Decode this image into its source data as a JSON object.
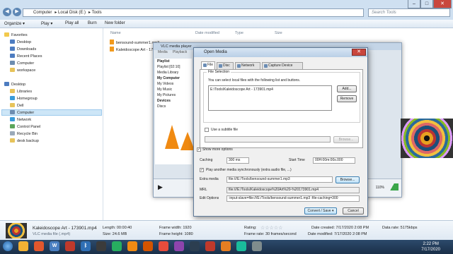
{
  "explorer": {
    "breadcrumb": [
      "Computer",
      "Local Disk (E:)",
      "Tools"
    ],
    "search_placeholder": "Search Tools",
    "toolbar": {
      "organize": "Organize ▾",
      "play": "Play ▾",
      "play_all": "Play all",
      "burn": "Burn",
      "new_folder": "New folder"
    },
    "columns": {
      "name": "Name",
      "date": "Date modified",
      "type": "Type",
      "size": "Size"
    },
    "files": [
      "bensound-summer1.mp3",
      "Kaleidoscope Art - 17"
    ],
    "tree": {
      "favorites": "Favorites",
      "fav_items": [
        "Desktop",
        "Downloads",
        "Recent Places",
        "Computer",
        "workspace"
      ],
      "desktop": "Desktop",
      "desk_items": [
        "Libraries",
        "Homegroup",
        "Dell",
        "Computer",
        "Network",
        "Control Panel",
        "Recycle Bin",
        "desk backup"
      ]
    }
  },
  "vlc": {
    "title": "VLC media player",
    "menu": [
      "Media",
      "Playback"
    ],
    "playlist_header": "Playlist",
    "sidebar": [
      "Playlist [02:10]",
      "Media Library",
      "My Computer",
      "My Videos",
      "My Music",
      "My Pictures",
      "Devices",
      "Discs"
    ],
    "volume": "110%"
  },
  "dialog": {
    "title": "Open Media",
    "tabs": [
      "File",
      "Disc",
      "Network",
      "Capture Device"
    ],
    "file_selection": "File Selection",
    "instruction": "You can select local files with the following list and buttons.",
    "file_path": "E:\\Tools\\Kaleidoscope Art - 173901.mp4",
    "add": "Add...",
    "remove": "Remove",
    "use_subtitle": "Use a subtitle file",
    "browse_disabled": "Browse...",
    "show_more": "Show more options",
    "caching_label": "Caching",
    "caching_value": "300 ms",
    "start_time_label": "Start Time",
    "start_time_value": "00H:00m:00s.000",
    "play_another": "Play another media synchronously (extra audio file, ...)",
    "extra_media_label": "Extra media",
    "extra_media_value": "file:///E:/Tools/bensound-summer1.mp3",
    "browse": "Browse...",
    "mrl_label": "MRL",
    "mrl_value": "file:///E:/Tools/Kaleidoscope%20Art%20-%20173901.mp4",
    "edit_label": "Edit Options",
    "edit_value": ":input-slave=file:///E:/Tools/bensound-summer1.mp3 :file-caching=300",
    "convert_save": "Convert / Save",
    "cancel": "Cancel"
  },
  "details": {
    "name": "Kaleidoscope Art - 173901.mp4",
    "type": "VLC media file (.mp4)",
    "length": "Length: 00:00:40",
    "size": "Size: 24.6 MB",
    "frame_width": "Frame width: 1920",
    "frame_height": "Frame height: 1080",
    "rating": "Rating:",
    "stars": "☆☆☆☆☆",
    "created": "Date created: 7/17/2020 2:08 PM",
    "modified": "Date modified: 7/17/2020 2:08 PM",
    "frame_rate": "Frame rate: 30 frames/second",
    "data_rate": "Data rate: 5175kbps"
  },
  "taskbar": {
    "time": "2:22 PM",
    "date": "7/17/2020"
  }
}
